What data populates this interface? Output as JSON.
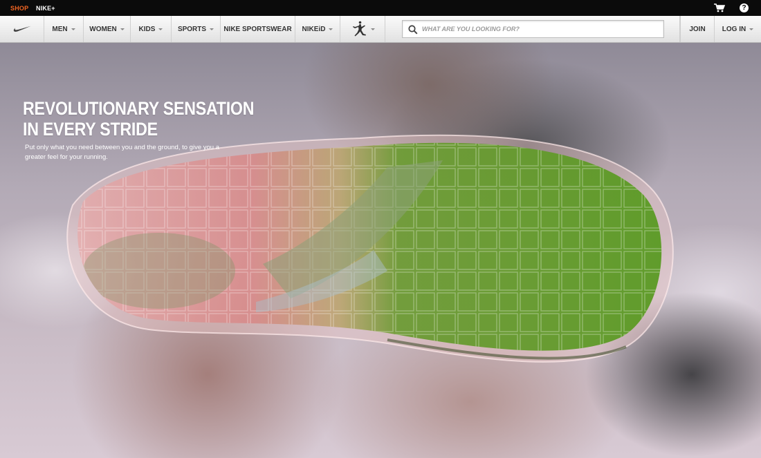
{
  "topbar": {
    "shop": "SHOP",
    "nikeplus": "NIKE+",
    "shop_color": "#f26522",
    "icons": [
      "cart-icon",
      "help-icon"
    ],
    "help_glyph": "?"
  },
  "nav": {
    "logo_icon": "nike-swoosh-icon",
    "items": [
      {
        "label": "MEN"
      },
      {
        "label": "WOMEN"
      },
      {
        "label": "KIDS"
      },
      {
        "label": "SPORTS"
      },
      {
        "label": "NIKE SPORTSWEAR"
      },
      {
        "label": "NIKEiD"
      }
    ],
    "jordan_icon": "jumpman-icon",
    "search": {
      "placeholder": "WHAT ARE YOU LOOKING FOR?",
      "value": ""
    },
    "join": "JOIN",
    "login": "LOG IN"
  },
  "hero": {
    "title_line1": "REVOLUTIONARY SENSATION",
    "title_line2": "IN EVERY STRIDE",
    "subtitle": "Put only what you need between you and the ground, to give you a greater feel for your running.",
    "image": "translucent running shoe sole with green and red pressure map"
  }
}
